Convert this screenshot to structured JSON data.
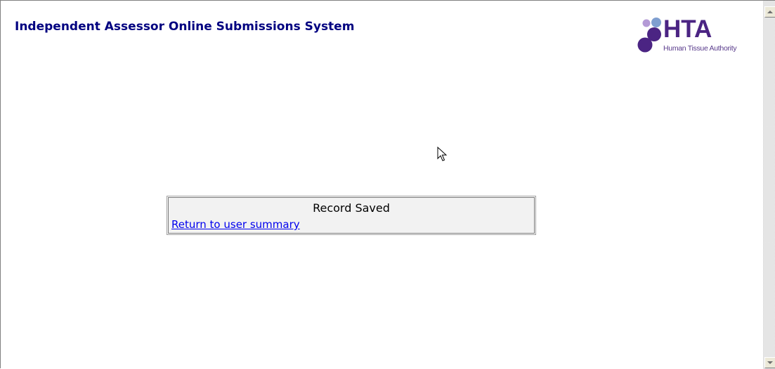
{
  "header": {
    "title": "Independent Assessor Online Submissions System",
    "logo": {
      "mark": "HTA",
      "subtitle": "Human Tissue Authority",
      "colors": {
        "primary": "#4b2483",
        "secondary": "#7f9fd0",
        "accent": "#b49ad6"
      }
    }
  },
  "message": {
    "status_text": "Record Saved",
    "link_label": "Return to user summary"
  },
  "scrollbar": {
    "up_icon": "scroll-up-arrow-icon",
    "down_icon": "scroll-down-arrow-icon"
  },
  "cursor": {
    "icon": "mouse-pointer-icon"
  },
  "colors": {
    "title": "#000080",
    "link": "#0000ee",
    "box_background": "#f2f2f2"
  }
}
